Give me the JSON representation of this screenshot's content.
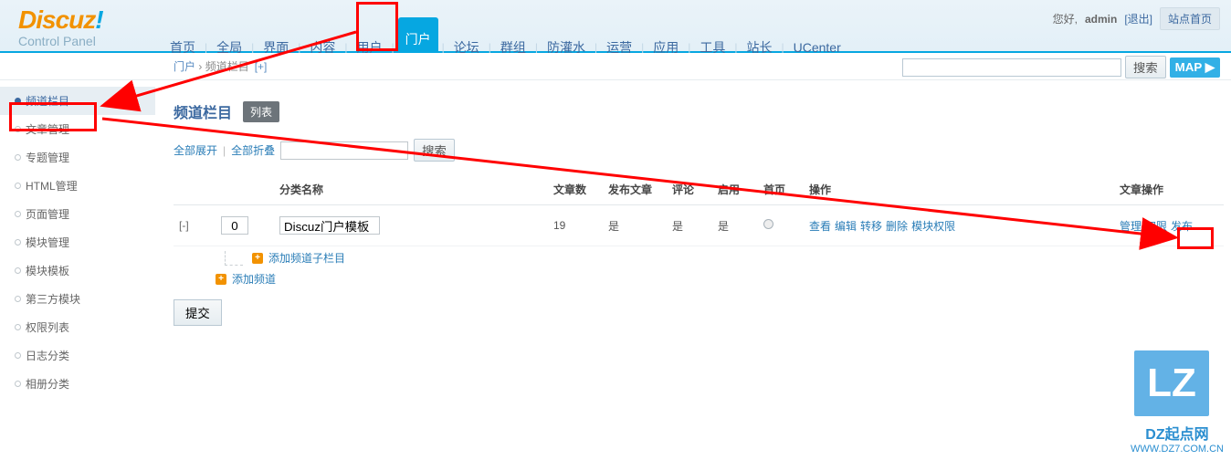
{
  "logo": {
    "brand": "Discuz",
    "bang": "!",
    "subtitle": "Control Panel"
  },
  "userbar": {
    "greet": "您好,",
    "user": "admin",
    "logout": "[退出]",
    "home": "站点首页"
  },
  "topnav": {
    "items": [
      "首页",
      "全局",
      "界面",
      "内容",
      "用户",
      "门户",
      "论坛",
      "群组",
      "防灌水",
      "运营",
      "应用",
      "工具",
      "站长",
      "UCenter"
    ],
    "active_index": 5
  },
  "breadcrumb": {
    "root": "门户",
    "sep": "›",
    "current": "频道栏目",
    "plus": "[+]"
  },
  "secsearch": {
    "btn": "搜索",
    "map": "MAP ▶"
  },
  "sidebar": {
    "items": [
      "频道栏目",
      "文章管理",
      "专题管理",
      "HTML管理",
      "页面管理",
      "模块管理",
      "模块模板",
      "第三方模块",
      "权限列表",
      "日志分类",
      "相册分类"
    ],
    "active_index": 0
  },
  "page": {
    "title": "频道栏目",
    "list_badge": "列表"
  },
  "toolbelt": {
    "expand": "全部展开",
    "collapse": "全部折叠",
    "search_btn": "搜索"
  },
  "table": {
    "headers": {
      "name": "分类名称",
      "articles": "文章数",
      "publish": "发布文章",
      "comment": "评论",
      "enable": "启用",
      "home": "首页",
      "ops": "操作",
      "article_ops": "文章操作"
    },
    "row": {
      "collapse": "[-]",
      "order": "0",
      "name": "Discuz门户模板",
      "articles": "19",
      "publish": "是",
      "comment": "是",
      "enable": "是",
      "ops": [
        "查看",
        "编辑",
        "转移",
        "删除",
        "模块权限"
      ],
      "art_ops": [
        "管理",
        "权限",
        "发布"
      ]
    },
    "add_sub": "添加频道子栏目",
    "add_chan": "添加频道"
  },
  "submit": "提交",
  "watermark": {
    "icon": "LZ",
    "label": "DZ起点网",
    "url": "WWW.DZ7.COM.CN"
  }
}
